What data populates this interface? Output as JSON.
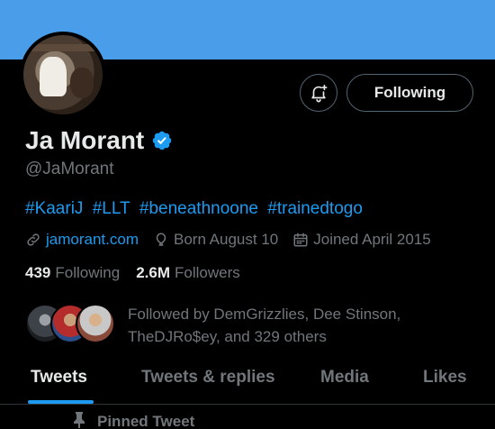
{
  "profile": {
    "name": "Ja Morant",
    "handle": "@JaMorant",
    "bio_tags": [
      "#KaariJ",
      "#LLT",
      "#beneathnoone",
      "#trainedtogo"
    ],
    "website": "jamorant.com",
    "born": "Born August 10",
    "joined": "Joined April 2015",
    "following_count": "439",
    "following_label": "Following",
    "followers_count": "2.6M",
    "followers_label": "Followers",
    "followed_by": "Followed by DemGrizzlies, Dee Stinson, TheDJRo$ey, and 329 others"
  },
  "actions": {
    "follow_button": "Following",
    "notification_icon": "bell-plus-icon"
  },
  "tabs": [
    {
      "label": "Tweets",
      "active": true
    },
    {
      "label": "Tweets & replies",
      "active": false
    },
    {
      "label": "Media",
      "active": false
    },
    {
      "label": "Likes",
      "active": false
    }
  ],
  "pinned_label": "Pinned Tweet",
  "colors": {
    "banner": "#4a9de8",
    "accent": "#1d9bf0",
    "background": "#000000",
    "muted": "#71767b"
  }
}
